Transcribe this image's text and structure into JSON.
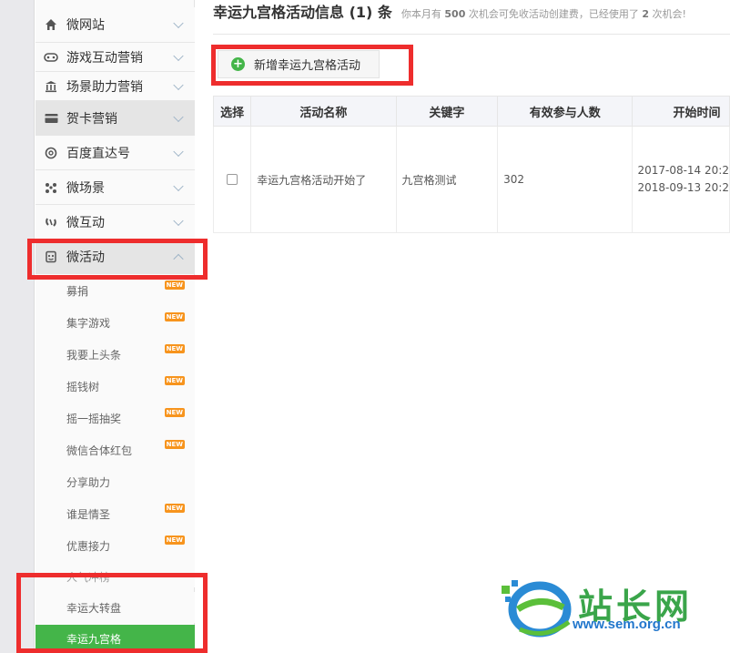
{
  "sidebar": {
    "items": [
      {
        "label": "微网站",
        "icon": "home-icon"
      },
      {
        "label": "游戏互动营销",
        "icon": "gamepad-icon"
      },
      {
        "label": "场景助力营销",
        "icon": "bank-icon"
      },
      {
        "label": "贺卡营销",
        "icon": "card-icon"
      },
      {
        "label": "百度直达号",
        "icon": "search-circle-icon"
      },
      {
        "label": "微场景",
        "icon": "scatter-icon"
      },
      {
        "label": "微互动",
        "icon": "link-icon"
      },
      {
        "label": "微活动",
        "icon": "activity-icon"
      }
    ],
    "sub_items": [
      {
        "label": "募捐",
        "badge": "NEW"
      },
      {
        "label": "集字游戏",
        "badge": "NEW"
      },
      {
        "label": "我要上头条",
        "badge": "NEW"
      },
      {
        "label": "摇钱树",
        "badge": "NEW"
      },
      {
        "label": "摇一摇抽奖",
        "badge": "NEW"
      },
      {
        "label": "微信合体红包",
        "badge": "NEW"
      },
      {
        "label": "分享助力",
        "badge": ""
      },
      {
        "label": "谁是情圣",
        "badge": "NEW"
      },
      {
        "label": "优惠接力",
        "badge": "NEW"
      },
      {
        "label": "人气冲榜",
        "badge": ""
      },
      {
        "label": "幸运大转盘",
        "badge": ""
      },
      {
        "label": "幸运九宫格",
        "badge": ""
      }
    ]
  },
  "main": {
    "title": "幸运九宫格活动信息 (1) 条",
    "note_prefix": "你本月有",
    "note_count": "500",
    "note_middle": "次机会可免收活动创建费，已经使用了",
    "note_used": "2",
    "note_suffix": "次机会!",
    "add_button_label": "新增幸运九宫格活动",
    "table": {
      "headers": [
        "选择",
        "活动名称",
        "关键字",
        "有效参与人数",
        "开始时间"
      ],
      "rows": [
        {
          "name": "幸运九宫格活动开始了",
          "keyword": "九宫格测试",
          "participants": "302",
          "start_time": "2017-08-14 20:2",
          "end_time": "2018-09-13 20:2"
        }
      ]
    }
  },
  "watermark": {
    "name": "站长网",
    "url": "www.sem.org.cn"
  },
  "colors": {
    "accent_green": "#44b549",
    "highlight_red": "#ee2d2d",
    "badge_orange": "#f7941d"
  }
}
